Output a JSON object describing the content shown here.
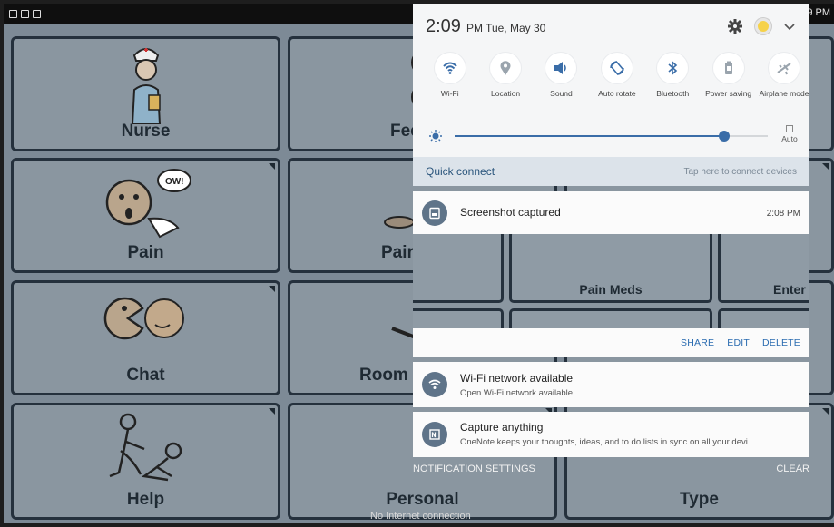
{
  "statusbar": {
    "time": "9 PM"
  },
  "grid": {
    "tiles": [
      {
        "label": "Nurse"
      },
      {
        "label": "Fee"
      },
      {
        "label": "Pain"
      },
      {
        "label": "Pair"
      },
      {
        "label": "Chat"
      },
      {
        "label": "Room"
      },
      {
        "label": "Help"
      },
      {
        "label": "Personal"
      },
      {
        "label": "Type"
      }
    ],
    "no_internet": "No Internet connection"
  },
  "quick_settings": {
    "time": "2:09",
    "date": "PM Tue, May 30",
    "toggles": [
      {
        "label": "Wi-Fi",
        "icon": "wifi-icon",
        "active": true
      },
      {
        "label": "Location",
        "icon": "location-icon",
        "active": false
      },
      {
        "label": "Sound",
        "icon": "sound-icon",
        "active": true
      },
      {
        "label": "Auto rotate",
        "icon": "rotate-icon",
        "active": true
      },
      {
        "label": "Bluetooth",
        "icon": "bluetooth-icon",
        "active": true
      },
      {
        "label": "Power saving",
        "icon": "battery-icon",
        "active": false
      },
      {
        "label": "Airplane mode",
        "icon": "airplane-icon",
        "active": false
      }
    ],
    "brightness_level": 0.86,
    "auto_label": "Auto",
    "accent": "#3a6da8"
  },
  "quick_connect": {
    "title": "Quick connect",
    "hint": "Tap here to connect devices"
  },
  "notifications": {
    "screenshot": {
      "title": "Screenshot captured",
      "time": "2:08 PM",
      "preview_labels": [
        "Pain Meds",
        "Enter"
      ],
      "actions": [
        "SHARE",
        "EDIT",
        "DELETE"
      ]
    },
    "wifi": {
      "title": "Wi-Fi network available",
      "subtitle": "Open Wi-Fi network available"
    },
    "onenote": {
      "title": "Capture anything",
      "subtitle": "OneNote keeps your thoughts, ideas, and to do lists in sync on all your devi..."
    }
  },
  "footer": {
    "settings": "NOTIFICATION SETTINGS",
    "clear": "CLEAR"
  }
}
